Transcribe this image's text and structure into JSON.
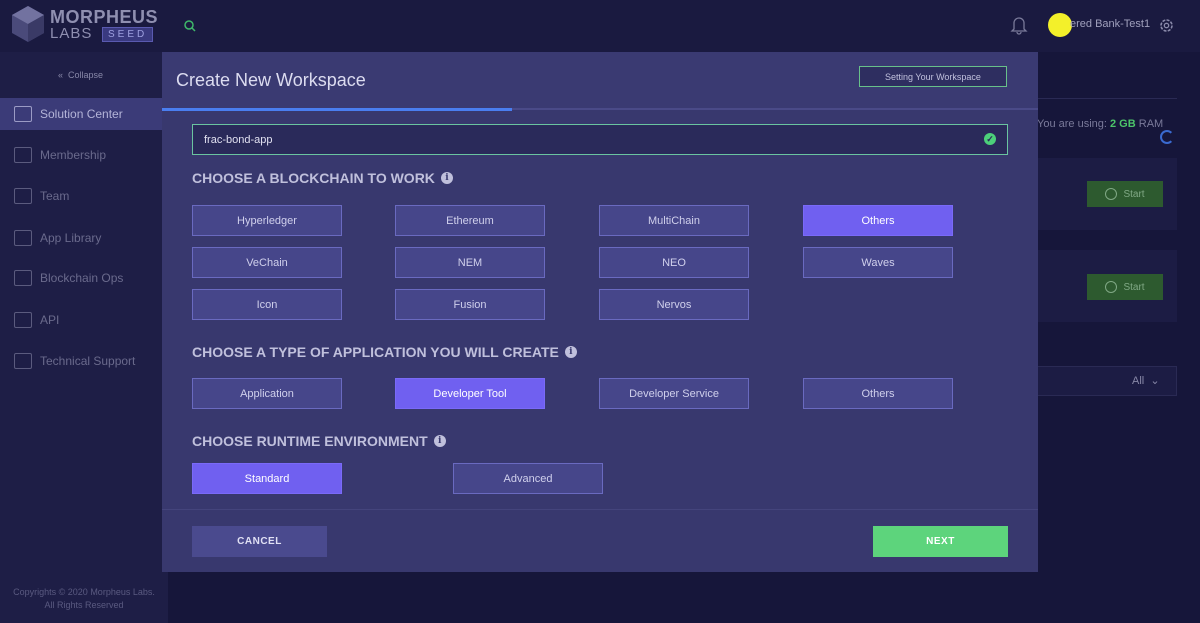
{
  "brand": {
    "name_top": "MORPHEUS",
    "name_bottom": "LABS",
    "edition": "SEED"
  },
  "header": {
    "username": "ered Bank-Test1"
  },
  "sidebar": {
    "collapse_label": "Collapse",
    "items": [
      {
        "label": "Solution Center",
        "icon": "solution-center-icon",
        "active": true
      },
      {
        "label": "Membership",
        "icon": "membership-icon"
      },
      {
        "label": "Team",
        "icon": "team-icon"
      },
      {
        "label": "App Library",
        "icon": "app-library-icon"
      },
      {
        "label": "Blockchain Ops",
        "icon": "blockchain-ops-icon"
      },
      {
        "label": "API",
        "icon": "api-icon"
      },
      {
        "label": "Technical Support",
        "icon": "technical-support-icon"
      }
    ],
    "copyright_line1": "Copyrights © 2020 Morpheus Labs.",
    "copyright_line2": "All Rights Reserved"
  },
  "background": {
    "ram_prefix": "You are using:",
    "ram_value": "2 GB",
    "ram_unit": "RAM",
    "start_label": "Start",
    "filter_value": "All"
  },
  "modal": {
    "title": "Create New Workspace",
    "setting_button": "Setting Your Workspace",
    "progress_fraction": 0.5,
    "workspace_name": "frac-bond-app",
    "blockchain_title": "CHOOSE A BLOCKCHAIN TO WORK",
    "blockchains": [
      "Hyperledger",
      "Ethereum",
      "MultiChain",
      "Others",
      "VeChain",
      "NEM",
      "NEO",
      "Waves",
      "Icon",
      "Fusion",
      "Nervos"
    ],
    "blockchain_selected": "Others",
    "apptype_title": "CHOOSE A TYPE OF APPLICATION YOU WILL CREATE",
    "apptypes": [
      "Application",
      "Developer Tool",
      "Developer Service",
      "Others"
    ],
    "apptype_selected": "Developer Tool",
    "runtime_title": "CHOOSE RUNTIME ENVIRONMENT",
    "runtimes": [
      "Standard",
      "Advanced"
    ],
    "runtime_selected": "Standard",
    "cancel_label": "CANCEL",
    "next_label": "NEXT"
  },
  "colors": {
    "accent": "#7060f0",
    "success": "#5dd47c",
    "modal_bg": "#38386e"
  }
}
